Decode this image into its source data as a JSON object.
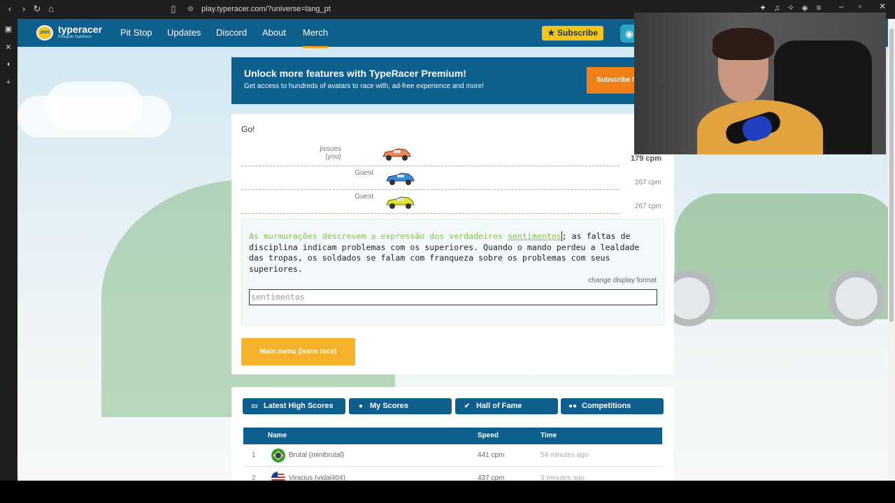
{
  "browser": {
    "url": "play.typeracer.com/?universe=lang_pt"
  },
  "header": {
    "logo_name": "typeracer",
    "logo_badge": "2000",
    "logo_sub": "Português TypeRacer",
    "nav": [
      "Pit Stop",
      "Updates",
      "Discord",
      "About",
      "Merch"
    ],
    "subscribe_label": "★ Subscribe"
  },
  "promo": {
    "title": "Unlock more features with TypeRacer Premium!",
    "description": "Get access to hundreds of avatars to race with, ad-free experience and more!",
    "button_label": "Subscribe N"
  },
  "race": {
    "status": "Go!",
    "racers": [
      {
        "name": "jissues",
        "note": "(you)",
        "cpm": "179 cpm",
        "car_color": "#e88a4f",
        "progress": 0.4
      },
      {
        "name": "Guest",
        "note": "",
        "cpm": "267 cpm",
        "car_color": "#3a8ad8",
        "progress": 0.41
      },
      {
        "name": "Guest",
        "note": "",
        "cpm": "267 cpm",
        "car_color": "#e4e52a",
        "progress": 0.41
      }
    ],
    "passage_typed": "As murmurações descrevem a expressão dos verdadeiros ",
    "passage_current": "sentimentos",
    "passage_rest": "; as faltas de disciplina indicam problemas com os superiores. Quando o mando perdeu a lealdade das tropas, os soldados se falam com franqueza sobre os problemas com seus superiores.",
    "change_display_label": "change display format",
    "input_value": "sentimentos",
    "leave_button_label": "Main menu (leave race)"
  },
  "scores": {
    "tabs": [
      {
        "label": "Latest High Scores",
        "icon": "monitor-icon"
      },
      {
        "label": "My Scores",
        "icon": "user-icon"
      },
      {
        "label": "Hall of Fame",
        "icon": "thumbs-up-icon"
      },
      {
        "label": "Competitions",
        "icon": "users-icon"
      }
    ],
    "columns": {
      "name": "Name",
      "speed": "Speed",
      "time": "Time"
    },
    "rows": [
      {
        "rank": "1",
        "flag": "brazil-flag-icon",
        "name": "Brutal (minibrutal)",
        "speed": "441 cpm",
        "time": "54 minutes ago"
      },
      {
        "rank": "2",
        "flag": "usa-flag-icon",
        "name": "Vinicius (vidal404)",
        "speed": "437 cpm",
        "time": "3 minutes ago"
      }
    ]
  },
  "colors": {
    "brand_blue": "#0d5f8e",
    "accent_orange": "#f6b22b",
    "typed_green": "#8bc34a"
  }
}
